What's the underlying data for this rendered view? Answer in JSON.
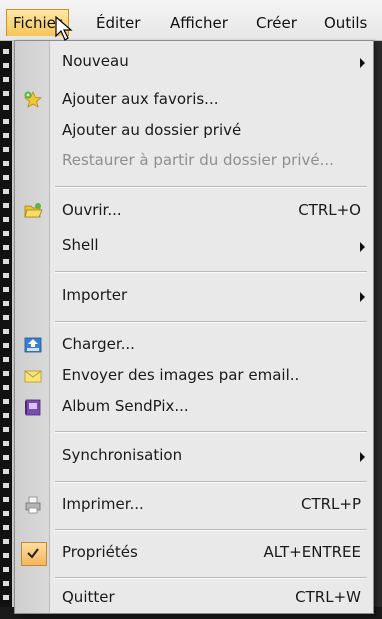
{
  "menubar": {
    "items": [
      {
        "label": "Fichier"
      },
      {
        "label": "Éditer"
      },
      {
        "label": "Afficher"
      },
      {
        "label": "Créer"
      },
      {
        "label": "Outils"
      }
    ]
  },
  "menu": {
    "items": [
      {
        "label": "Nouveau",
        "submenu": true
      },
      {
        "label": "Ajouter aux favoris...",
        "icon": "star-add-icon"
      },
      {
        "label": "Ajouter au dossier privé"
      },
      {
        "label": "Restaurer à partir du dossier privé...",
        "disabled": true
      },
      {
        "label": "Ouvrir...",
        "shortcut": "CTRL+O",
        "icon": "folder-open-icon"
      },
      {
        "label": "Shell",
        "submenu": true
      },
      {
        "label": "Importer",
        "submenu": true
      },
      {
        "label": "Charger...",
        "icon": "upload-icon"
      },
      {
        "label": "Envoyer des images par email..",
        "icon": "email-icon"
      },
      {
        "label": "Album SendPix...",
        "icon": "album-icon"
      },
      {
        "label": "Synchronisation",
        "submenu": true
      },
      {
        "label": "Imprimer...",
        "shortcut": "CTRL+P",
        "icon": "printer-icon"
      },
      {
        "label": "Propriétés",
        "shortcut": "ALT+ENTREE",
        "icon": "checkmark-icon",
        "checked": true
      },
      {
        "label": "Quitter",
        "shortcut": "CTRL+W"
      }
    ]
  }
}
